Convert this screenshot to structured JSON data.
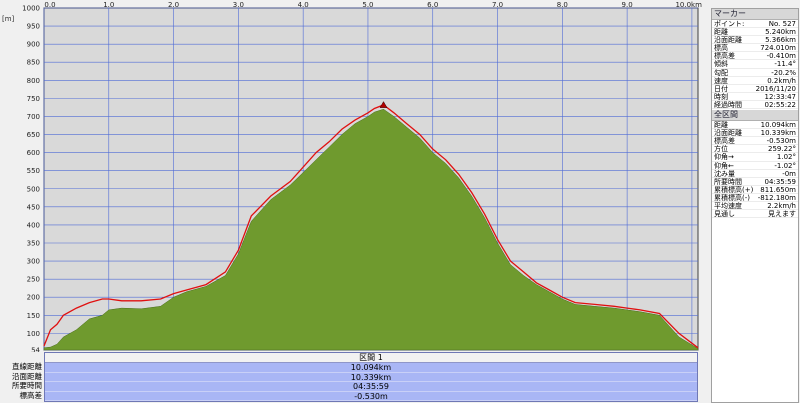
{
  "chart_data": {
    "type": "area",
    "x_ticks": [
      "0.0",
      "1.0",
      "2.0",
      "3.0",
      "4.0",
      "5.0",
      "6.0",
      "7.0",
      "8.0",
      "9.0",
      "10.0km"
    ],
    "y_ticks": [
      "54",
      "100",
      "150",
      "200",
      "250",
      "300",
      "350",
      "400",
      "450",
      "500",
      "550",
      "600",
      "650",
      "700",
      "750",
      "800",
      "850",
      "900",
      "950",
      "1000"
    ],
    "y_unit": "[m]",
    "xlim": [
      0,
      10.094
    ],
    "ylim": [
      54,
      1000
    ],
    "grid": true,
    "fill_color": "#6f9a2e",
    "line_color": "#e01010",
    "x": [
      0,
      0.1,
      0.2,
      0.3,
      0.5,
      0.7,
      0.9,
      1.0,
      1.2,
      1.5,
      1.8,
      2.0,
      2.2,
      2.5,
      2.8,
      3.0,
      3.2,
      3.5,
      3.8,
      4.0,
      4.2,
      4.4,
      4.6,
      4.8,
      5.0,
      5.1,
      5.24,
      5.4,
      5.6,
      5.8,
      6.0,
      6.2,
      6.4,
      6.6,
      6.8,
      7.0,
      7.2,
      7.4,
      7.6,
      7.8,
      8.0,
      8.2,
      8.5,
      8.8,
      9.0,
      9.2,
      9.5,
      9.8,
      10.094
    ],
    "terrain": [
      60,
      62,
      70,
      90,
      110,
      140,
      150,
      165,
      170,
      168,
      175,
      200,
      215,
      230,
      260,
      320,
      410,
      470,
      510,
      545,
      580,
      615,
      650,
      680,
      700,
      712,
      720,
      700,
      670,
      640,
      600,
      570,
      530,
      480,
      420,
      350,
      290,
      260,
      235,
      215,
      195,
      180,
      175,
      170,
      165,
      160,
      150,
      90,
      58
    ],
    "track": [
      65,
      110,
      125,
      150,
      170,
      185,
      195,
      195,
      190,
      190,
      195,
      210,
      220,
      235,
      270,
      330,
      425,
      480,
      520,
      560,
      600,
      630,
      665,
      690,
      710,
      722,
      732,
      710,
      680,
      650,
      610,
      580,
      540,
      490,
      430,
      360,
      300,
      270,
      240,
      220,
      200,
      185,
      180,
      175,
      170,
      165,
      155,
      100,
      60
    ],
    "marker": {
      "x": 5.24,
      "y": 730
    }
  },
  "section": {
    "title": "区間 1",
    "labels": [
      "直線距離",
      "沿面距離",
      "所要時間",
      "標高差"
    ],
    "values": [
      "10.094km",
      "10.339km",
      "04:35:59",
      "-0.530m"
    ]
  },
  "marker_panel": {
    "title": "マーカー",
    "rows": [
      {
        "k": "ポイント:",
        "v": "No. 527"
      },
      {
        "k": "距離",
        "v": "5.240km"
      },
      {
        "k": "沿面距離",
        "v": "5.366km"
      },
      {
        "k": "標高",
        "v": "724.010m"
      },
      {
        "k": "標高差",
        "v": "-0.410m"
      },
      {
        "k": "傾斜",
        "v": "-11.4°"
      },
      {
        "k": "勾配",
        "v": "-20.2%"
      },
      {
        "k": "速度",
        "v": "0.2km/h"
      },
      {
        "k": "日付",
        "v": "2016/11/20"
      },
      {
        "k": "時刻",
        "v": "12:33:47"
      },
      {
        "k": "経過時間",
        "v": "02:55:22"
      }
    ]
  },
  "total_panel": {
    "title": "全区間",
    "rows": [
      {
        "k": "距離",
        "v": "10.094km"
      },
      {
        "k": "沿面距離",
        "v": "10.339km"
      },
      {
        "k": "標高差",
        "v": "-0.530m"
      },
      {
        "k": "方位",
        "v": "259.22°"
      },
      {
        "k": "仰角→",
        "v": "1.02°"
      },
      {
        "k": "仰角←",
        "v": "-1.02°"
      },
      {
        "k": "沈み量",
        "v": "-0m"
      },
      {
        "k": "所要時間",
        "v": "04:35:59"
      },
      {
        "k": "累積標高(+)",
        "v": "811.650m"
      },
      {
        "k": "累積標高(-)",
        "v": "-812.180m"
      },
      {
        "k": "平均速度",
        "v": "2.2km/h"
      },
      {
        "k": "見通し",
        "v": "見えます"
      }
    ]
  }
}
